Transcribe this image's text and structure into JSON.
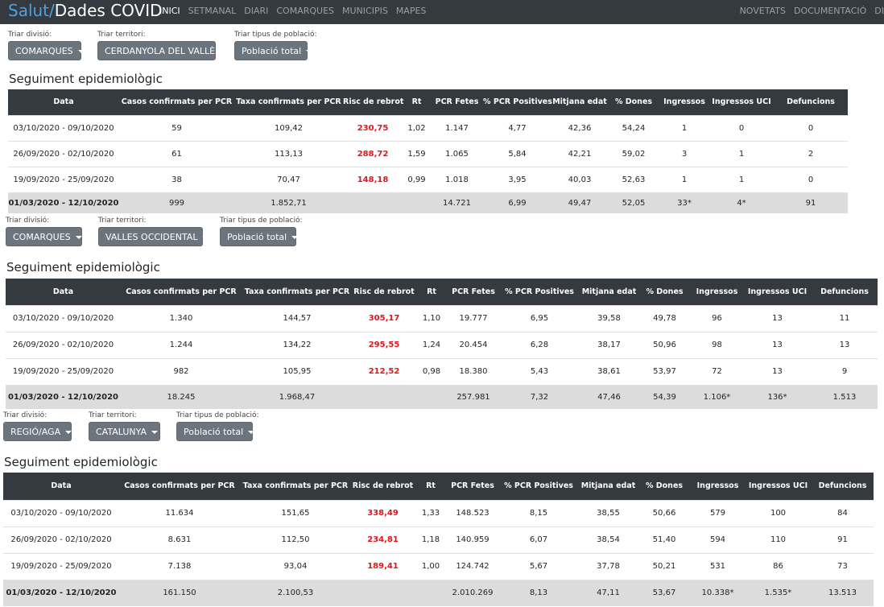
{
  "header": {
    "brand_part1": "Salut/",
    "brand_part2": "Dades COVID",
    "nav_left": [
      "INICI",
      "SETMANAL",
      "DIARI",
      "COMARQUES",
      "MUNICIPIS",
      "MAPES"
    ],
    "nav_right": [
      "NOVETATS",
      "DOCUMENTACIÓ",
      "DI"
    ]
  },
  "labels": {
    "division": "Triar divisió:",
    "territory": "Triar territori:",
    "population": "Triar tipus de població:",
    "section_title": "Seguiment epidemiològic"
  },
  "columns": [
    "Data",
    "Casos confirmats per PCR",
    "Taxa confirmats per PCR",
    "Risc de rebrot",
    "Rt",
    "PCR Fetes",
    "% PCR Positives",
    "Mitjana edat",
    "% Dones",
    "Ingressos",
    "Ingressos UCI",
    "Defuncions"
  ],
  "sections": [
    {
      "division": "COMARQUES",
      "territory": "CERDANYOLA DEL VALLÈS",
      "population": "Població total",
      "rows": [
        [
          "03/10/2020 - 09/10/2020",
          "59",
          "109,42",
          "230,75",
          "1,02",
          "1.147",
          "4,77",
          "42,36",
          "54,24",
          "1",
          "0",
          "0"
        ],
        [
          "26/09/2020 - 02/10/2020",
          "61",
          "113,13",
          "288,72",
          "1,59",
          "1.065",
          "5,84",
          "42,21",
          "59,02",
          "3",
          "1",
          "2"
        ],
        [
          "19/09/2020 - 25/09/2020",
          "38",
          "70,47",
          "148,18",
          "0,99",
          "1.018",
          "3,95",
          "40,03",
          "52,63",
          "1",
          "1",
          "0"
        ]
      ],
      "total": [
        "01/03/2020 - 12/10/2020",
        "999",
        "1.852,71",
        "",
        "",
        "14.721",
        "6,99",
        "49,47",
        "52,05",
        "33*",
        "4*",
        "91"
      ]
    },
    {
      "division": "COMARQUES",
      "territory": "VALLES OCCIDENTAL",
      "population": "Població total",
      "rows": [
        [
          "03/10/2020 - 09/10/2020",
          "1.340",
          "144,57",
          "305,17",
          "1,10",
          "19.777",
          "6,95",
          "39,58",
          "49,78",
          "96",
          "13",
          "11"
        ],
        [
          "26/09/2020 - 02/10/2020",
          "1.244",
          "134,22",
          "295,55",
          "1,24",
          "20.454",
          "6,28",
          "38,17",
          "50,96",
          "98",
          "13",
          "13"
        ],
        [
          "19/09/2020 - 25/09/2020",
          "982",
          "105,95",
          "212,52",
          "0,98",
          "18.380",
          "5,43",
          "38,61",
          "53,97",
          "72",
          "13",
          "9"
        ]
      ],
      "total": [
        "01/03/2020 - 12/10/2020",
        "18.245",
        "1.968,47",
        "",
        "",
        "257.981",
        "7,32",
        "47,46",
        "54,39",
        "1.106*",
        "136*",
        "1.513"
      ]
    },
    {
      "division": "REGIÓ/AGA",
      "territory": "CATALUNYA",
      "population": "Població total",
      "rows": [
        [
          "03/10/2020 - 09/10/2020",
          "11.634",
          "151,65",
          "338,49",
          "1,33",
          "148.523",
          "8,15",
          "38,55",
          "50,66",
          "579",
          "100",
          "84"
        ],
        [
          "26/09/2020 - 02/10/2020",
          "8.631",
          "112,50",
          "234,81",
          "1,18",
          "140.959",
          "6,07",
          "38,54",
          "51,40",
          "594",
          "110",
          "91"
        ],
        [
          "19/09/2020 - 25/09/2020",
          "7.138",
          "93,04",
          "189,41",
          "1,00",
          "124.742",
          "5,67",
          "37,78",
          "50,21",
          "531",
          "86",
          "73"
        ]
      ],
      "total": [
        "01/03/2020 - 12/10/2020",
        "161.150",
        "2.100,53",
        "",
        "",
        "2.010.269",
        "8,13",
        "47,11",
        "53,67",
        "10.338*",
        "1.535*",
        "13.513"
      ]
    }
  ]
}
